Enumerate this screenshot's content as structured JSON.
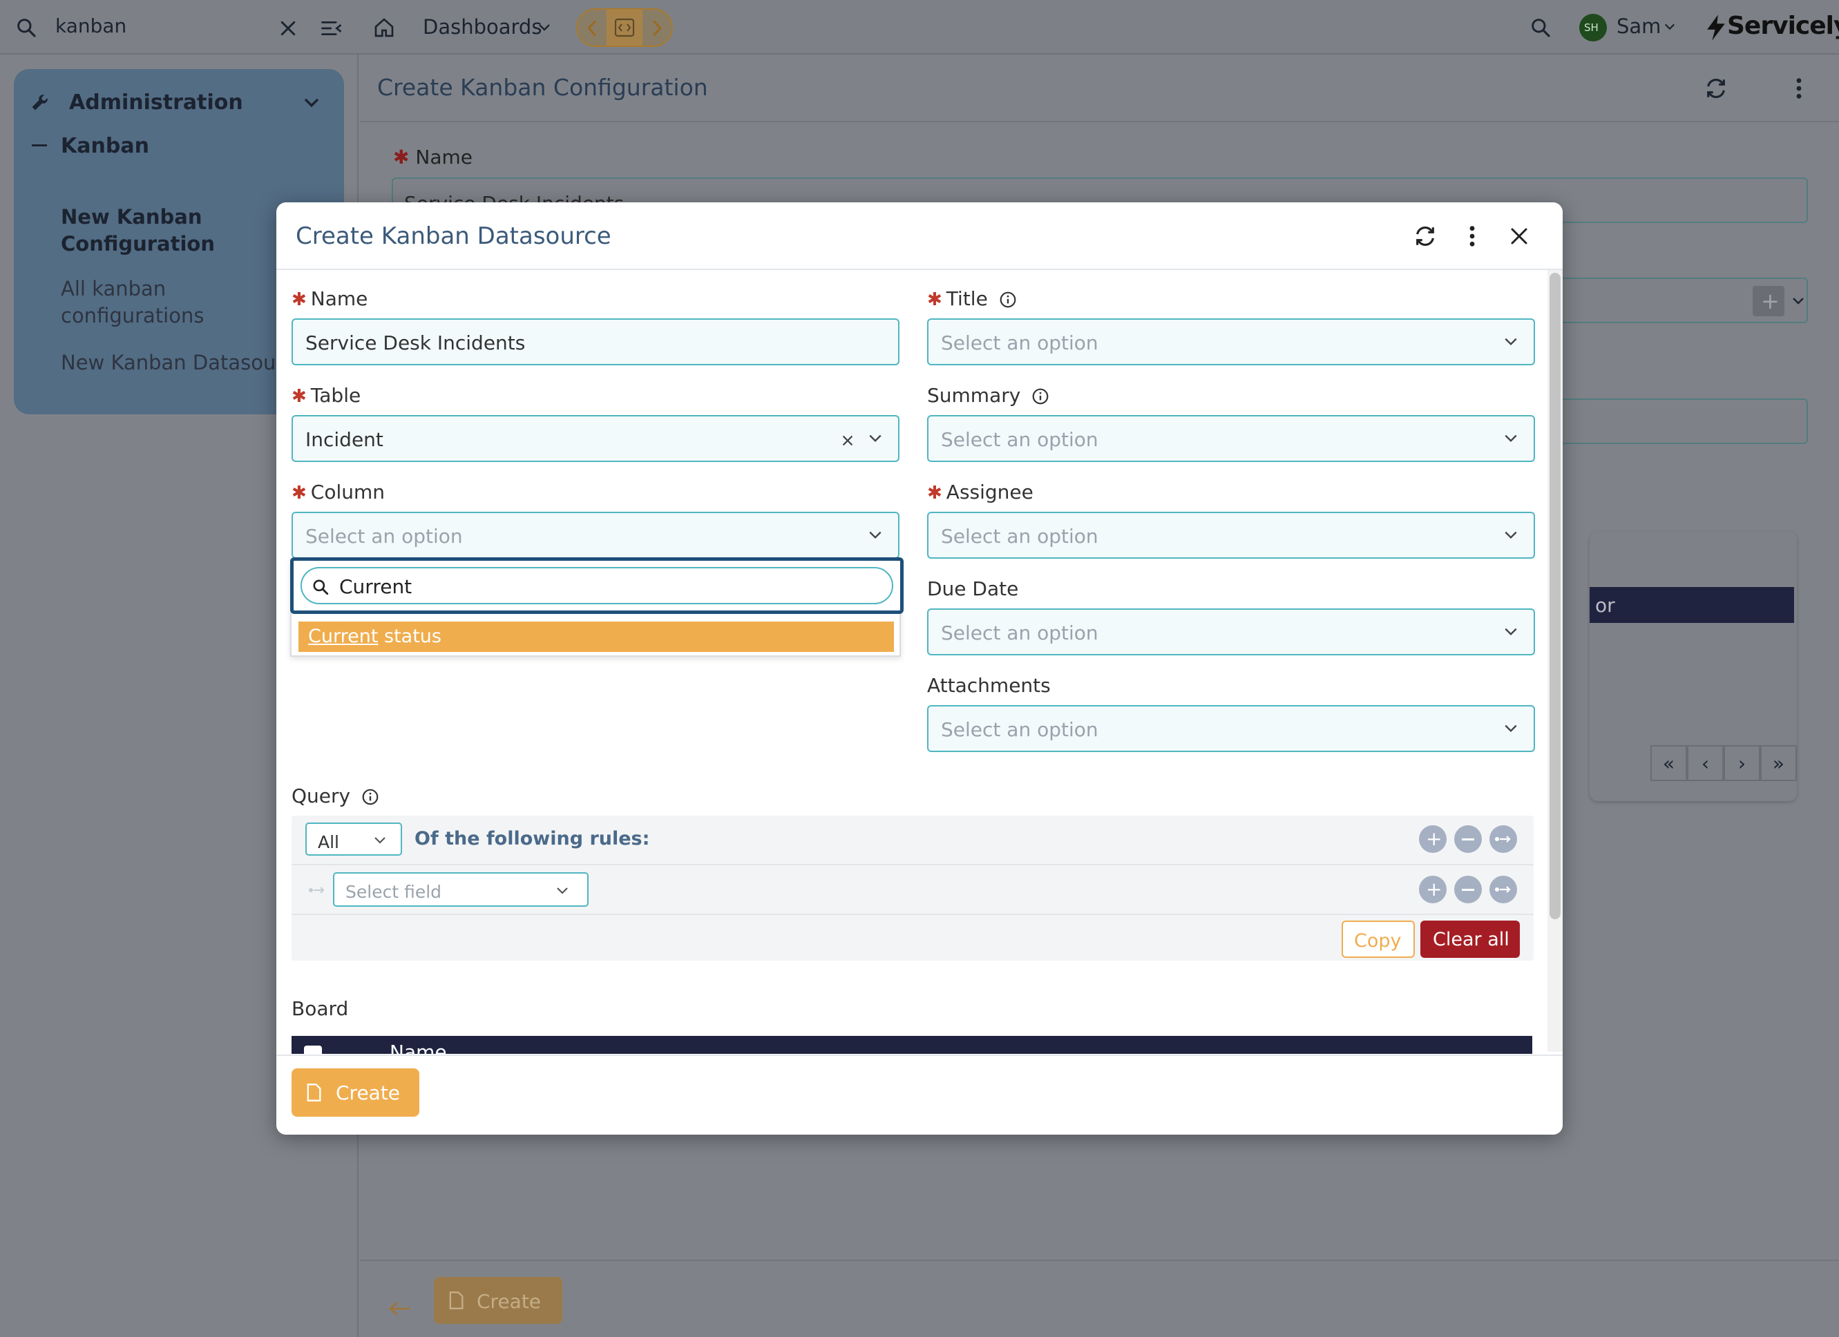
{
  "topbar": {
    "search_value": "kanban",
    "dashboards_label": "Dashboards",
    "user_initials": "SH",
    "user_name": "Sam",
    "brand": "Servicely"
  },
  "sidebar": {
    "section_title": "Administration",
    "group_title": "Kanban",
    "items": [
      {
        "label_line1": "New Kanban",
        "label_line2": "Configuration"
      },
      {
        "label_line1": "All kanban",
        "label_line2": "configurations"
      },
      {
        "label_line1": "New Kanban Datasour"
      }
    ]
  },
  "page": {
    "title": "Create Kanban Configuration",
    "name_label": "Name",
    "name_value": "Service Desk Incidents",
    "table_header_partial": "or",
    "footer_create_label": "Create"
  },
  "modal": {
    "title": "Create Kanban Datasource",
    "name_label": "Name",
    "name_value": "Service Desk Incidents",
    "table_label": "Table",
    "table_value": "Incident",
    "column_label": "Column",
    "column_placeholder": "Select an option",
    "column_search_value": "Current",
    "column_option_match": "Current",
    "column_option_rest": " status",
    "title_label": "Title",
    "title_placeholder": "Select an option",
    "summary_label": "Summary",
    "summary_placeholder": "Select an option",
    "assignee_label": "Assignee",
    "assignee_placeholder": "Select an option",
    "due_date_label": "Due Date",
    "due_date_placeholder": "Select an option",
    "attachments_label": "Attachments",
    "attachments_placeholder": "Select an option",
    "query_label": "Query",
    "query_match_value": "All",
    "query_rules_text": "Of the following rules:",
    "select_field_placeholder": "Select field",
    "copy_label": "Copy",
    "clear_all_label": "Clear all",
    "board_label": "Board",
    "board_col_name": "Name",
    "create_label": "Create"
  },
  "colors": {
    "accent": "#f0ad4e",
    "danger": "#a51d24",
    "field_border": "#4fb6c1",
    "focus": "#1d4f7a",
    "table_header": "#1f2340"
  }
}
